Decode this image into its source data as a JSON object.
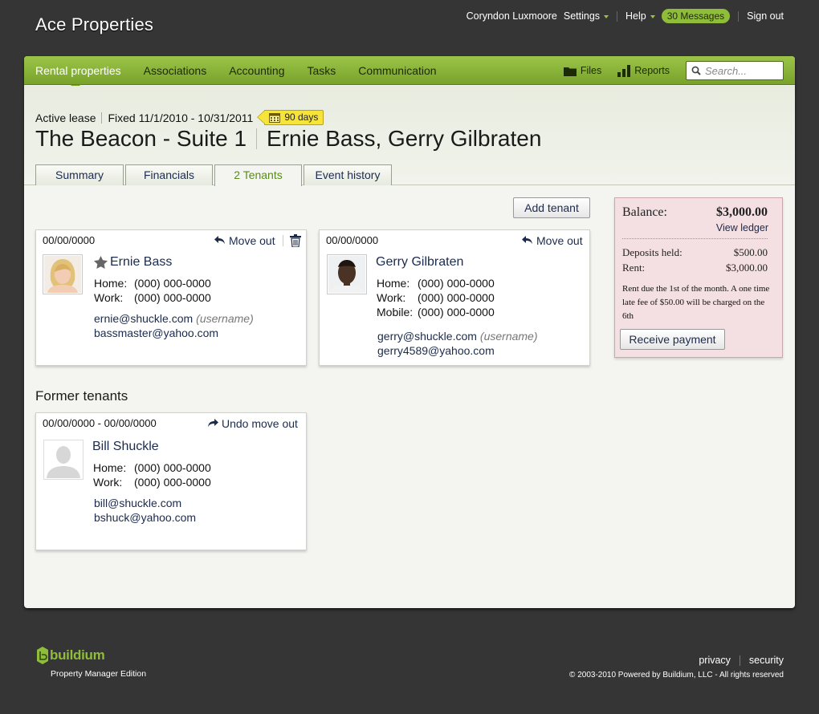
{
  "app_title": "Ace Properties",
  "topbar": {
    "user": "Coryndon Luxmoore",
    "settings": "Settings",
    "help": "Help",
    "messages": "30 Messages",
    "signout": "Sign out"
  },
  "nav": {
    "items": [
      "Rental properties",
      "Associations",
      "Accounting",
      "Tasks",
      "Communication"
    ],
    "files": "Files",
    "reports": "Reports",
    "search_placeholder": "Search..."
  },
  "lease": {
    "status": "Active lease",
    "term": "Fixed 11/1/2010 - 10/31/2011",
    "days_badge": "90 days",
    "property": "The Beacon - Suite 1",
    "tenants_names": "Ernie Bass, Gerry Gilbraten"
  },
  "tabs": [
    "Summary",
    "Financials",
    "2 Tenants",
    "Event history"
  ],
  "active_tab": "2 Tenants",
  "add_tenant_label": "Add tenant",
  "tenants": [
    {
      "date": "00/00/0000",
      "move_out": "Move out",
      "name": "Ernie Bass",
      "primary": true,
      "phones": [
        {
          "label": "Home:",
          "value": "(000) 000-0000"
        },
        {
          "label": "Work:",
          "value": "(000) 000-0000"
        }
      ],
      "email_primary": "ernie@shuckle.com",
      "username_note": "(username)",
      "email_secondary": "bassmaster@yahoo.com"
    },
    {
      "date": "00/00/0000",
      "move_out": "Move out",
      "name": "Gerry Gilbraten",
      "primary": false,
      "phones": [
        {
          "label": "Home:",
          "value": "(000) 000-0000"
        },
        {
          "label": "Work:",
          "value": "(000) 000-0000"
        },
        {
          "label": "Mobile:",
          "value": "(000) 000-0000"
        }
      ],
      "email_primary": "gerry@shuckle.com",
      "username_note": "(username)",
      "email_secondary": "gerry4589@yahoo.com"
    }
  ],
  "former_title": "Former tenants",
  "former": {
    "date": "00/00/0000 - 00/00/0000",
    "undo": "Undo move out",
    "name": "Bill Shuckle",
    "phones": [
      {
        "label": "Home:",
        "value": "(000) 000-0000"
      },
      {
        "label": "Work:",
        "value": "(000) 000-0000"
      }
    ],
    "email_primary": "bill@shuckle.com",
    "email_secondary": "bshuck@yahoo.com"
  },
  "balance": {
    "label": "Balance:",
    "amount": "$3,000.00",
    "view_ledger": "View ledger",
    "deposits_label": "Deposits held:",
    "deposits_value": "$500.00",
    "rent_label": "Rent:",
    "rent_value": "$3,000.00",
    "note": "Rent due the 1st of the month. A one time late fee of $50.00 will be charged on the 6th",
    "receive_payment": "Receive payment"
  },
  "footer": {
    "brand": "buildium",
    "edition": "Property Manager Edition",
    "privacy": "privacy",
    "security": "security",
    "copyright": "© 2003-2010 Powered by Buildium, LLC - All rights reserved"
  },
  "colors": {
    "nav_green": "#8ab73c",
    "background": "#353535",
    "link_blue": "#1b2b4d",
    "balance_pink": "#f4dfe2",
    "badge_yellow": "#f6e43a"
  }
}
